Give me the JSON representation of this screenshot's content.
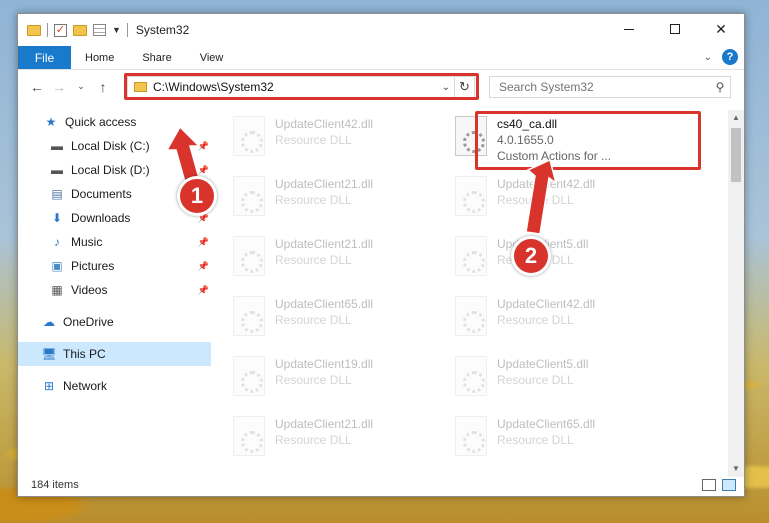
{
  "window": {
    "title": "System32"
  },
  "ribbon": {
    "tabs": [
      "File",
      "Home",
      "Share",
      "View"
    ]
  },
  "nav": {
    "address": "C:\\Windows\\System32",
    "search_placeholder": "Search System32"
  },
  "sidebar": {
    "items": [
      {
        "label": "Quick access"
      },
      {
        "label": "Local Disk (C:)"
      },
      {
        "label": "Local Disk (D:)"
      },
      {
        "label": "Documents"
      },
      {
        "label": "Downloads"
      },
      {
        "label": "Music"
      },
      {
        "label": "Pictures"
      },
      {
        "label": "Videos"
      },
      {
        "label": "OneDrive"
      },
      {
        "label": "This PC"
      },
      {
        "label": "Network"
      }
    ]
  },
  "files": {
    "highlighted": {
      "name": "cs40_ca.dll",
      "version": "4.0.1655.0",
      "description": "Custom Actions for ..."
    },
    "left_column": [
      {
        "name": "UpdateClient42.dll",
        "desc": "Resource DLL"
      },
      {
        "name": "UpdateClient21.dll",
        "desc": "Resource DLL"
      },
      {
        "name": "UpdateClient21.dll",
        "desc": "Resource DLL"
      },
      {
        "name": "UpdateClient65.dll",
        "desc": "Resource DLL"
      },
      {
        "name": "UpdateClient19.dll",
        "desc": "Resource DLL"
      },
      {
        "name": "UpdateClient21.dll",
        "desc": "Resource DLL"
      }
    ],
    "right_column": [
      {
        "name": "UpdateClient42.dll",
        "desc": "Resource DLL"
      },
      {
        "name": "UpdateClient5.dll",
        "desc": "Resource DLL"
      },
      {
        "name": "UpdateClient42.dll",
        "desc": "Resource DLL"
      },
      {
        "name": "UpdateClient5.dll",
        "desc": "Resource DLL"
      },
      {
        "name": "UpdateClient65.dll",
        "desc": "Resource DLL"
      }
    ]
  },
  "status": {
    "items": "184 items"
  },
  "annotations": {
    "step1": "1",
    "step2": "2",
    "color": "#d9342b"
  }
}
